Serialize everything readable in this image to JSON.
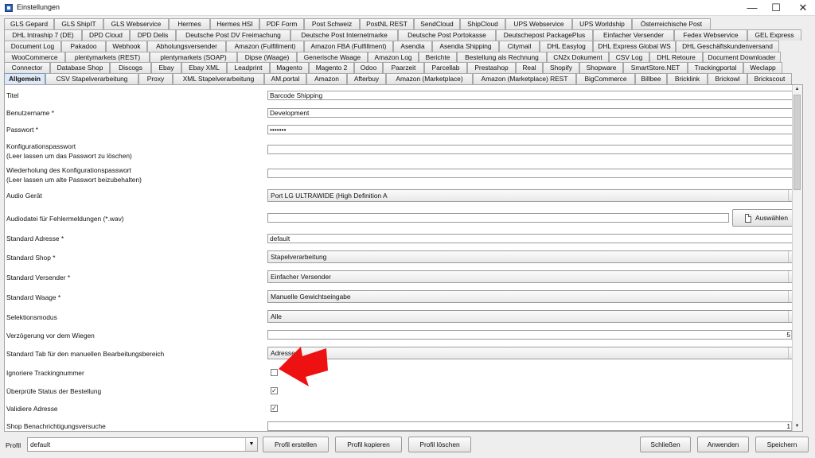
{
  "window": {
    "title": "Einstellungen",
    "minimize": "—",
    "maximize": "☐",
    "close": "✕"
  },
  "tabs": {
    "rows": [
      [
        "GLS Gepard",
        "GLS ShipIT",
        "GLS Webservice",
        "Hermes",
        "Hermes HSI",
        "PDF Form",
        "Post Schweiz",
        "PostNL REST",
        "SendCloud",
        "ShipCloud",
        "UPS Webservice",
        "UPS Worldship",
        "Österreichische Post"
      ],
      [
        "DHL Intraship 7 (DE)",
        "DPD Cloud",
        "DPD Delis",
        "Deutsche Post DV Freimachung",
        "Deutsche Post Internetmarke",
        "Deutsche Post Portokasse",
        "Deutschepost PackagePlus",
        "Einfacher Versender",
        "Fedex Webservice",
        "GEL Express"
      ],
      [
        "Document Log",
        "Pakadoo",
        "Webhook",
        "Abholungsversender",
        "Amazon (Fulfillment)",
        "Amazon FBA (Fulfillment)",
        "Asendia",
        "Asendia Shipping",
        "Citymail",
        "DHL Easylog",
        "DHL Express Global WS",
        "DHL Geschäftskundenversand"
      ],
      [
        "WooCommerce",
        "plentymarkets (REST)",
        "plentymarkets (SOAP)",
        "Dipse (Waage)",
        "Generische Waage",
        "Amazon Log",
        "Berichte",
        "Bestellung als Rechnung",
        "CN2x Dokument",
        "CSV Log",
        "DHL Retoure",
        "Document Downloader"
      ],
      [
        "Connector",
        "Database Shop",
        "Discogs",
        "Ebay",
        "Ebay XML",
        "Leadprint",
        "Magento",
        "Magento 2",
        "Odoo",
        "Paarzeit",
        "Parcellab",
        "Prestashop",
        "Real",
        "Shopify",
        "Shopware",
        "SmartStore.NET",
        "Trackingportal",
        "Weclapp"
      ],
      [
        "Allgemein",
        "CSV Stapelverarbeitung",
        "Proxy",
        "XML Stapelverarbeitung",
        "AM.portal",
        "Amazon",
        "Afterbuy",
        "Amazon (Marketplace)",
        "Amazon (Marketplace) REST",
        "BigCommerce",
        "Billbee",
        "Bricklink",
        "Brickowl",
        "Brickscout"
      ]
    ],
    "active": "Allgemein"
  },
  "settings": {
    "titel": {
      "label": "Titel",
      "value": "Barcode Shipping"
    },
    "benutzername": {
      "label": "Benutzername *",
      "value": "Development"
    },
    "passwort": {
      "label": "Passwort *",
      "value": "•••••••"
    },
    "konfig_passwort": {
      "label": "Konfigurationspasswort",
      "hint": "(Leer lassen um das Passwort zu löschen)",
      "value": ""
    },
    "konfig_wiederholung": {
      "label": "Wiederholung des Konfigurationspasswort",
      "hint": "(Leer lassen um alte Passwort beizubehalten)",
      "value": ""
    },
    "audio_geraet": {
      "label": "Audio Gerät",
      "value": "Port LG ULTRAWIDE (High Definition A"
    },
    "audiodatei": {
      "label": "Audiodatei für Fehlermeldungen (*.wav)",
      "value": "",
      "button": "Auswählen"
    },
    "standard_adresse": {
      "label": "Standard Adresse *",
      "value": "default"
    },
    "standard_shop": {
      "label": "Standard Shop *",
      "value": "Stapelverarbeitung"
    },
    "standard_versender": {
      "label": "Standard Versender *",
      "value": "Einfacher Versender"
    },
    "standard_waage": {
      "label": "Standard Waage *",
      "value": "Manuelle Gewichtseingabe"
    },
    "selektionsmodus": {
      "label": "Selektionsmodus",
      "value": "Alle"
    },
    "verzoegerung": {
      "label": "Verzögerung vor dem Wiegen",
      "value": "5"
    },
    "standard_tab": {
      "label": "Standard Tab für den manuellen Bearbeitungsbereich",
      "value": "Adresse"
    },
    "ignoriere_tracking": {
      "label": "Ignoriere Trackingnummer",
      "checked": false
    },
    "ueberpruefe_status": {
      "label": "Überprüfe Status der Bestellung",
      "checked": true
    },
    "validiere_adresse": {
      "label": "Validiere Adresse",
      "checked": true
    },
    "shop_benachrichtigung": {
      "label": "Shop Benachrichtigungsversuche",
      "value": "1"
    }
  },
  "bottom": {
    "profil_label": "Profil",
    "profil_value": "default",
    "profil_erstellen": "Profil erstellen",
    "profil_kopieren": "Profil kopieren",
    "profil_loeschen": "Profil löschen",
    "schliessen": "Schließen",
    "anwenden": "Anwenden",
    "speichern": "Speichern"
  },
  "annotation_color": "#ee1111"
}
